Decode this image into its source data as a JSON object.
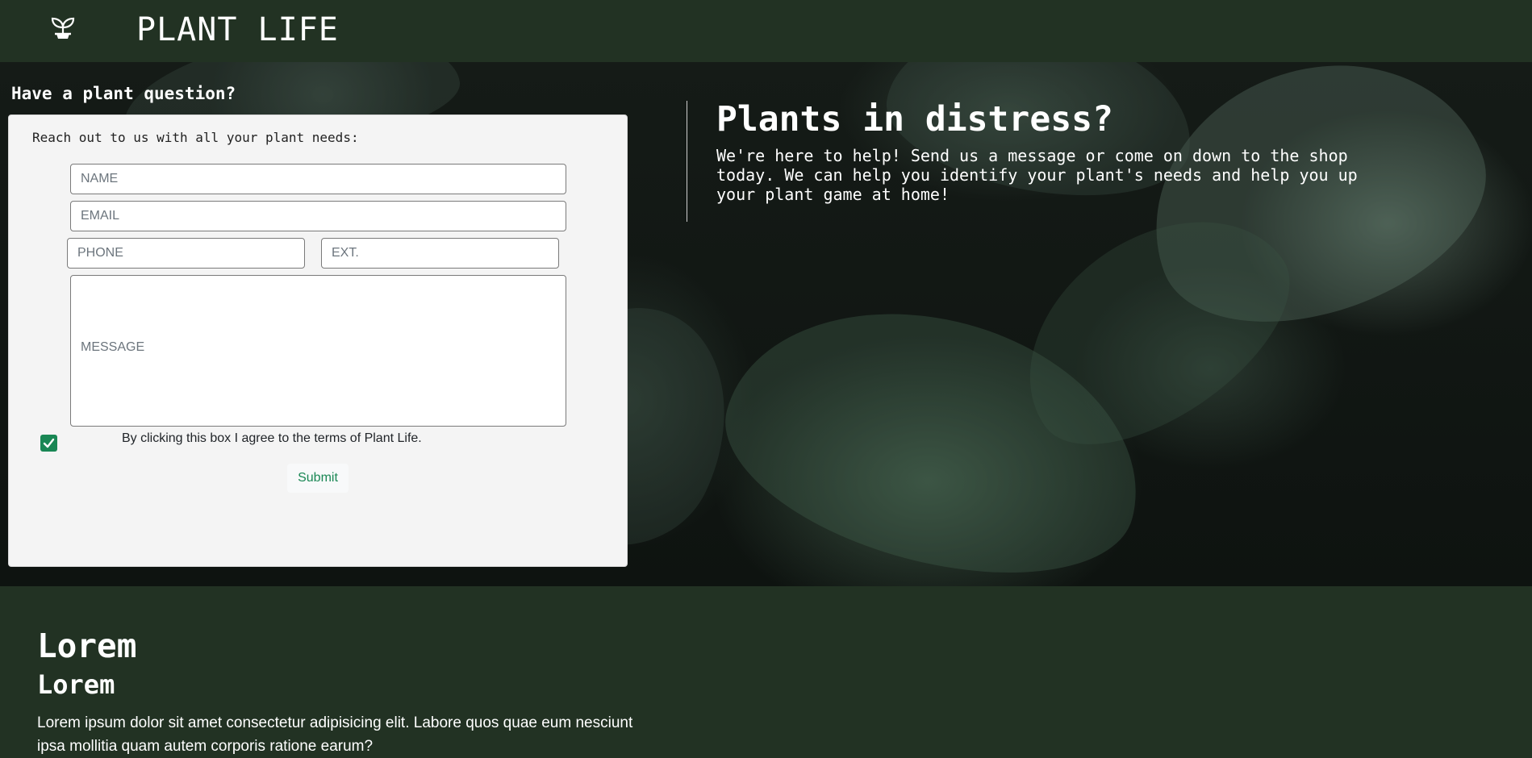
{
  "nav": {
    "brand": "PLANT LIFE",
    "logo_icon": "sprout-icon"
  },
  "contact": {
    "question": "Have a plant question?",
    "intro": "Reach out to us with all your plant needs:",
    "name_placeholder": "NAME",
    "email_placeholder": "EMAIL",
    "phone_placeholder": "PHONE",
    "ext_placeholder": "EXT.",
    "message_placeholder": "MESSAGE",
    "agree_checked": true,
    "agree_label": "By clicking this box I agree to the terms of Plant Life.",
    "submit_label": "Submit"
  },
  "distress": {
    "title": "Plants in distress?",
    "body": "We're here to help! Send us a message or come on down to the shop today. We can help you identify your plant's needs and help you up your plant game at home!"
  },
  "lower": {
    "heading": "Lorem",
    "subheading": "Lorem",
    "paragraph": "Lorem ipsum dolor sit amet consectetur adipisicing elit. Labore quos quae eum nesciunt ipsa mollitia quam autem corporis ratione earum?"
  },
  "colors": {
    "nav_bg": "#223223",
    "accent": "#198754",
    "card_bg": "#f4f4f4"
  }
}
